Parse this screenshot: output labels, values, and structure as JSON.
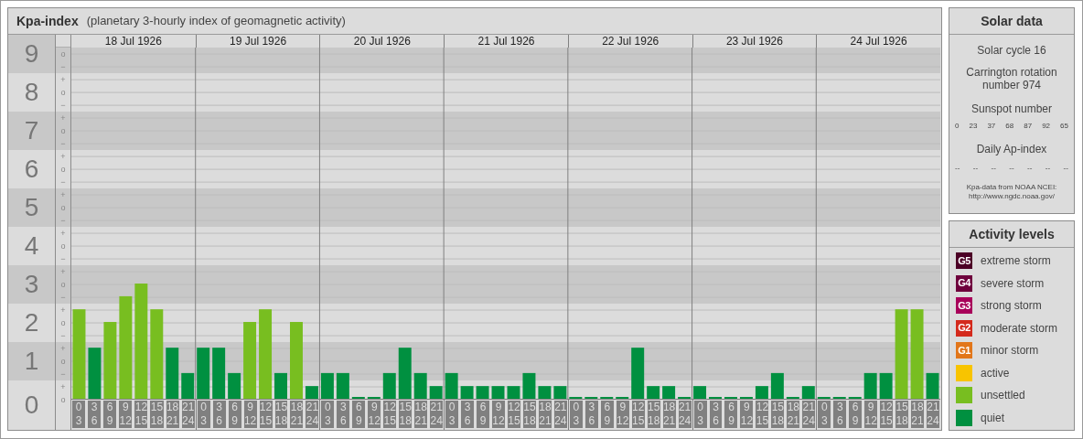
{
  "kp_panel": {
    "title": "Kpa-index",
    "subtitle": "(planetary 3-hourly index of geomagnetic activity)",
    "sublevels": [
      "o",
      "−",
      "+",
      "o",
      "−",
      "+",
      "o",
      "−",
      "+",
      "o",
      "−",
      "+",
      "o",
      "−",
      "+",
      "o",
      "−",
      "+",
      "o",
      "−",
      "+",
      "o",
      "−",
      "+",
      "o",
      "−",
      "+",
      "o"
    ],
    "days": [
      {
        "date": "18 Jul 1926",
        "slots": [
          {
            "from": "0",
            "to": "3"
          },
          {
            "from": "3",
            "to": "6"
          },
          {
            "from": "6",
            "to": "9"
          },
          {
            "from": "9",
            "to": "12"
          },
          {
            "from": "12",
            "to": "15"
          },
          {
            "from": "15",
            "to": "18"
          },
          {
            "from": "18",
            "to": "21"
          },
          {
            "from": "21",
            "to": "24"
          }
        ]
      },
      {
        "date": "19 Jul 1926",
        "slots": [
          {
            "from": "0",
            "to": "3"
          },
          {
            "from": "3",
            "to": "6"
          },
          {
            "from": "6",
            "to": "9"
          },
          {
            "from": "9",
            "to": "12"
          },
          {
            "from": "12",
            "to": "15"
          },
          {
            "from": "15",
            "to": "18"
          },
          {
            "from": "18",
            "to": "21"
          },
          {
            "from": "21",
            "to": "24"
          }
        ]
      },
      {
        "date": "20 Jul 1926",
        "slots": [
          {
            "from": "0",
            "to": "3"
          },
          {
            "from": "3",
            "to": "6"
          },
          {
            "from": "6",
            "to": "9"
          },
          {
            "from": "9",
            "to": "12"
          },
          {
            "from": "12",
            "to": "15"
          },
          {
            "from": "15",
            "to": "18"
          },
          {
            "from": "18",
            "to": "21"
          },
          {
            "from": "21",
            "to": "24"
          }
        ]
      },
      {
        "date": "21 Jul 1926",
        "slots": [
          {
            "from": "0",
            "to": "3"
          },
          {
            "from": "3",
            "to": "6"
          },
          {
            "from": "6",
            "to": "9"
          },
          {
            "from": "9",
            "to": "12"
          },
          {
            "from": "12",
            "to": "15"
          },
          {
            "from": "15",
            "to": "18"
          },
          {
            "from": "18",
            "to": "21"
          },
          {
            "from": "21",
            "to": "24"
          }
        ]
      },
      {
        "date": "22 Jul 1926",
        "slots": [
          {
            "from": "0",
            "to": "3"
          },
          {
            "from": "3",
            "to": "6"
          },
          {
            "from": "6",
            "to": "9"
          },
          {
            "from": "9",
            "to": "12"
          },
          {
            "from": "12",
            "to": "15"
          },
          {
            "from": "15",
            "to": "18"
          },
          {
            "from": "18",
            "to": "21"
          },
          {
            "from": "21",
            "to": "24"
          }
        ]
      },
      {
        "date": "23 Jul 1926",
        "slots": [
          {
            "from": "0",
            "to": "3"
          },
          {
            "from": "3",
            "to": "6"
          },
          {
            "from": "6",
            "to": "9"
          },
          {
            "from": "9",
            "to": "12"
          },
          {
            "from": "12",
            "to": "15"
          },
          {
            "from": "15",
            "to": "18"
          },
          {
            "from": "18",
            "to": "21"
          },
          {
            "from": "21",
            "to": "24"
          }
        ]
      },
      {
        "date": "24 Jul 1926",
        "slots": [
          {
            "from": "0",
            "to": "3"
          },
          {
            "from": "3",
            "to": "6"
          },
          {
            "from": "6",
            "to": "9"
          },
          {
            "from": "9",
            "to": "12"
          },
          {
            "from": "12",
            "to": "15"
          },
          {
            "from": "15",
            "to": "18"
          },
          {
            "from": "18",
            "to": "21"
          },
          {
            "from": "21",
            "to": "24"
          }
        ]
      }
    ],
    "chart_data": {
      "type": "bar",
      "ylim": [
        0,
        9.17
      ],
      "grid": true,
      "yticks": [
        9,
        8,
        7,
        6,
        5,
        4,
        3,
        2,
        1,
        0
      ],
      "series": [
        {
          "color": "#009040",
          "values": [
            null,
            1.33,
            null,
            null,
            null,
            null,
            1.33,
            0.67,
            1.33,
            1.33,
            0.67,
            null,
            null,
            0.67,
            null,
            0.33,
            0.67,
            0.67,
            0,
            0,
            0.67,
            1.33,
            0.67,
            0.33,
            0.67,
            0.33,
            0.33,
            0.33,
            0.33,
            0.67,
            0.33,
            0.33,
            0,
            0,
            0,
            0,
            1.33,
            0.33,
            0.33,
            0,
            0.33,
            0,
            0,
            0,
            0.33,
            0.67,
            0,
            0.33,
            0,
            0,
            0,
            0.67,
            0.67,
            null,
            null,
            0.67
          ]
        },
        {
          "color": "#78be20",
          "values": [
            2.33,
            null,
            2,
            2.67,
            3,
            2.33,
            null,
            null,
            null,
            null,
            null,
            2,
            2.33,
            null,
            2,
            null,
            null,
            null,
            null,
            null,
            null,
            null,
            null,
            null,
            null,
            null,
            null,
            null,
            null,
            null,
            null,
            null,
            null,
            null,
            null,
            null,
            null,
            null,
            null,
            null,
            null,
            null,
            null,
            null,
            null,
            null,
            null,
            null,
            null,
            null,
            null,
            null,
            null,
            2.33,
            2.33,
            null
          ]
        }
      ]
    }
  },
  "solar_data": {
    "title": "Solar data",
    "solar_cycle": "Solar cycle 16",
    "carrington": "Carrington rotation number 974",
    "sunspot_label": "Sunspot number",
    "sunspots": [
      "0",
      "23",
      "37",
      "68",
      "87",
      "92",
      "65"
    ],
    "ap_label": "Daily Ap-index",
    "ap_values": [
      "--",
      "--",
      "--",
      "--",
      "--",
      "--",
      "--"
    ],
    "source": "Kpa-data from NOAA NCEI:",
    "source_url": "http://www.ngdc.noaa.gov/"
  },
  "activity_levels": {
    "title": "Activity levels",
    "items": [
      {
        "badge": "G5",
        "label": "extreme storm",
        "color": "#4c0026"
      },
      {
        "badge": "G4",
        "label": "severe storm",
        "color": "#6e003c"
      },
      {
        "badge": "G3",
        "label": "strong storm",
        "color": "#a8005a"
      },
      {
        "badge": "G2",
        "label": "moderate storm",
        "color": "#d42a1c"
      },
      {
        "badge": "G1",
        "label": "minor storm",
        "color": "#e2761a"
      },
      {
        "label": "active",
        "color": "#f8c400"
      },
      {
        "label": "unsettled",
        "color": "#78be20"
      },
      {
        "label": "quiet",
        "color": "#009040"
      }
    ]
  }
}
